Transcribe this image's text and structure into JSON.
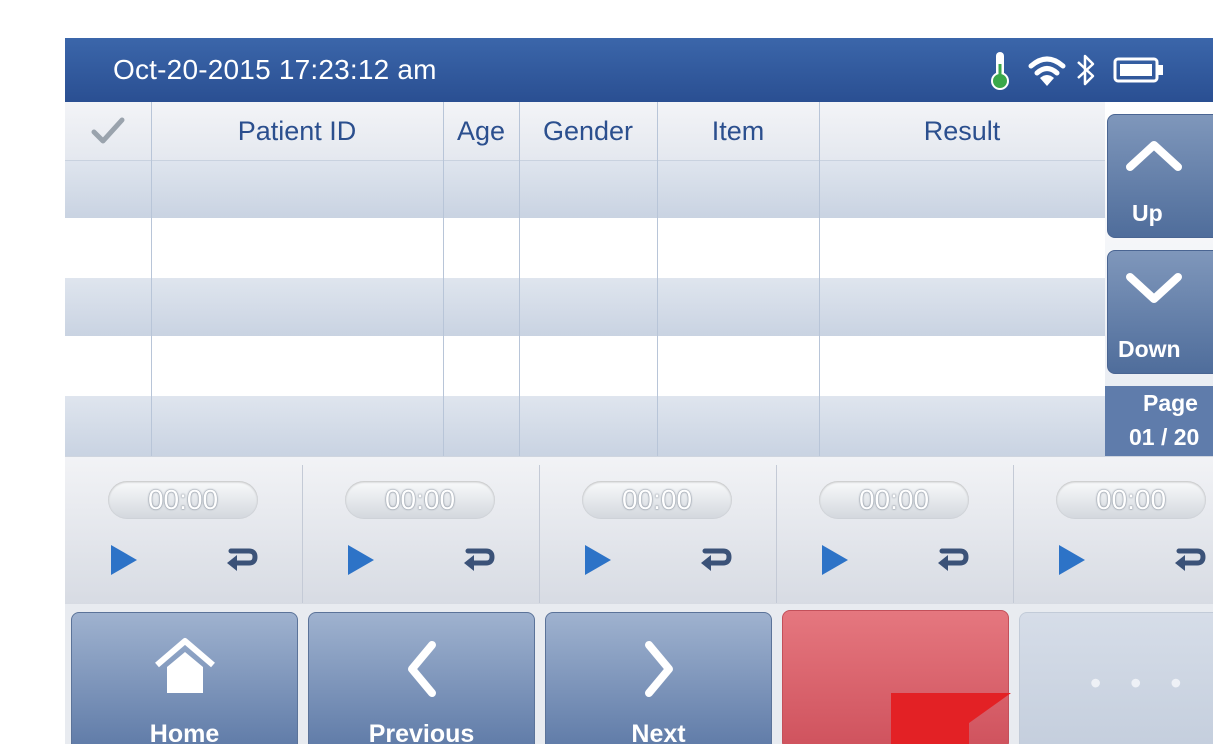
{
  "status_bar": {
    "datetime": "Oct-20-2015  17:23:12 am",
    "icons": [
      "thermometer-icon",
      "wifi-icon",
      "bluetooth-icon",
      "battery-icon"
    ]
  },
  "table": {
    "columns": [
      {
        "key": "select",
        "label": "",
        "icon": "checkmark-icon"
      },
      {
        "key": "patient_id",
        "label": "Patient ID"
      },
      {
        "key": "age",
        "label": "Age"
      },
      {
        "key": "gender",
        "label": "Gender"
      },
      {
        "key": "item",
        "label": "Item"
      },
      {
        "key": "result",
        "label": "Result"
      }
    ],
    "rows": [
      {
        "patient_id": "",
        "age": "",
        "gender": "",
        "item": "",
        "result": ""
      },
      {
        "patient_id": "",
        "age": "",
        "gender": "",
        "item": "",
        "result": ""
      },
      {
        "patient_id": "",
        "age": "",
        "gender": "",
        "item": "",
        "result": ""
      },
      {
        "patient_id": "",
        "age": "",
        "gender": "",
        "item": "",
        "result": ""
      },
      {
        "patient_id": "",
        "age": "",
        "gender": "",
        "item": "",
        "result": ""
      }
    ]
  },
  "pager": {
    "up_label": "Up",
    "down_label": "Down",
    "page_label": "Page",
    "page_value": "01 / 20"
  },
  "timers": [
    {
      "time": "00:00",
      "play_icon": "play-icon",
      "reset_icon": "reset-icon"
    },
    {
      "time": "00:00",
      "play_icon": "play-icon",
      "reset_icon": "reset-icon"
    },
    {
      "time": "00:00",
      "play_icon": "play-icon",
      "reset_icon": "reset-icon"
    },
    {
      "time": "00:00",
      "play_icon": "play-icon",
      "reset_icon": "reset-icon"
    },
    {
      "time": "00:00",
      "play_icon": "play-icon",
      "reset_icon": "reset-icon"
    }
  ],
  "bottom_bar": {
    "home_label": "Home",
    "previous_label": "Previous",
    "next_label": "Next",
    "more_label": "• • •"
  },
  "colors": {
    "header_blue": "#2f5aa0",
    "accent_red": "#e32125",
    "play_blue": "#2d73c7"
  }
}
